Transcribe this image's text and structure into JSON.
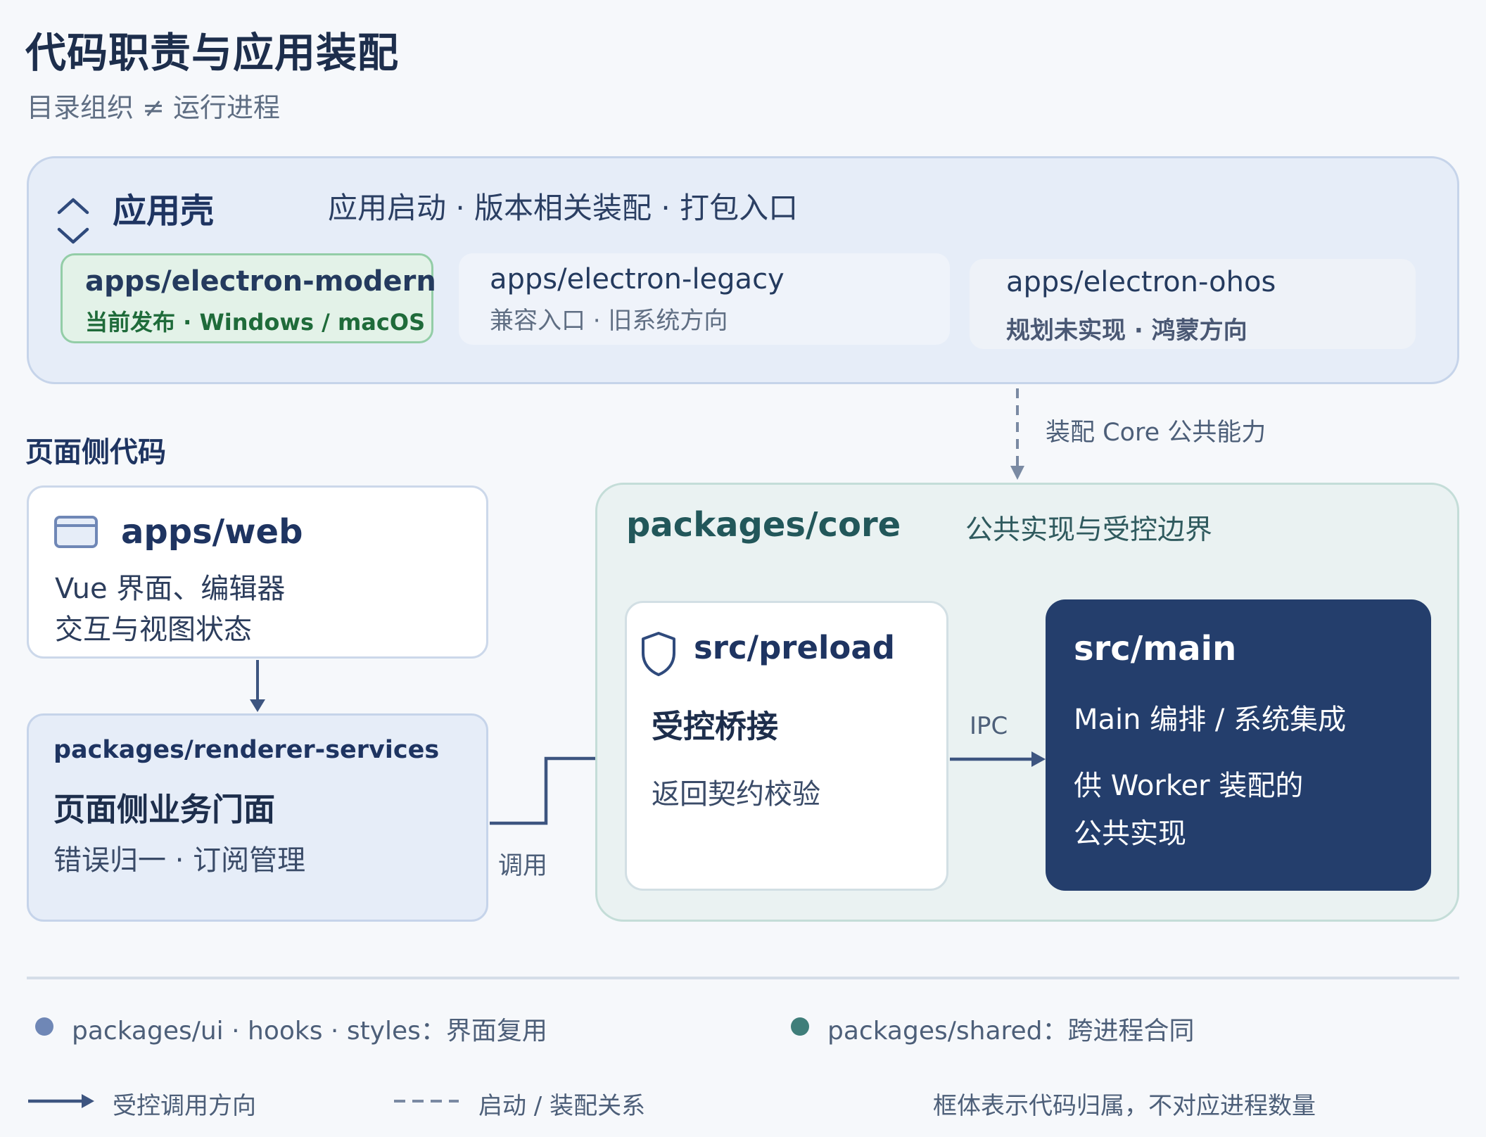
{
  "header": {
    "title": "代码职责与应用装配",
    "subtitle": "目录组织 ≠ 运行进程"
  },
  "shell": {
    "name": "应用壳",
    "description": "应用启动 · 版本相关装配 · 打包入口",
    "cards": [
      {
        "path": "apps/electron-modern",
        "note": "当前发布 · Windows / macOS",
        "status_color": "#1f6b3a"
      },
      {
        "path": "apps/electron-legacy",
        "note": "兼容入口 · 旧系统方向",
        "status_color": "#5f6e83"
      },
      {
        "path": "apps/electron-ohos",
        "note": "规划未实现 · 鸿蒙方向",
        "status_color": "#4a5874"
      }
    ],
    "link_label": "装配 Core 公共能力"
  },
  "page_side": {
    "section_label": "页面侧代码",
    "web": {
      "path": "apps/web",
      "line1": "Vue 界面、编辑器",
      "line2": "交互与视图状态"
    },
    "renderer_services": {
      "path": "packages/renderer-services",
      "title": "页面侧业务门面",
      "description": "错误归一 · 订阅管理"
    },
    "call_label": "调用"
  },
  "core": {
    "path": "packages/core",
    "description": "公共实现与受控边界",
    "preload": {
      "path": "src/preload",
      "title": "受控桥接",
      "description": "返回契约校验"
    },
    "ipc_label": "IPC",
    "main": {
      "path": "src/main",
      "line1": "Main 编排 / 系统集成",
      "line2": "供 Worker 装配的",
      "line3": "公共实现"
    }
  },
  "legend": {
    "ui_packages": "packages/ui · hooks · styles：界面复用",
    "shared_package": "packages/shared：跨进程合同",
    "solid_arrow": "受控调用方向",
    "dashed_line": "启动 / 装配关系",
    "footnote": "框体表示代码归属，不对应进程数量"
  },
  "colors": {
    "accent_navy": "#243e6c",
    "ui_dot": "#6f87b6",
    "shared_dot": "#3f7e7a",
    "modern_card_bg": "#e3f2e8"
  }
}
